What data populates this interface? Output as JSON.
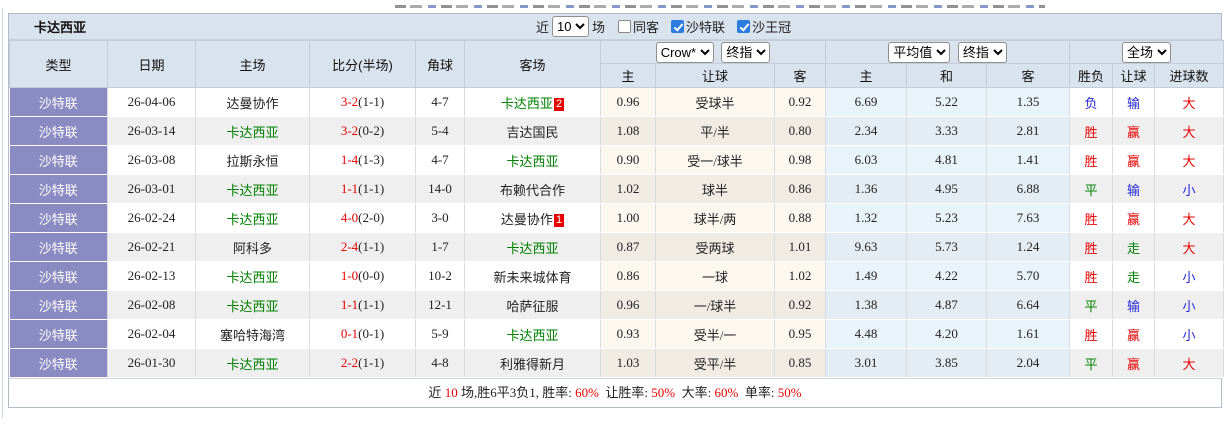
{
  "title_bar": {
    "team": "卡达西亚",
    "near_label": "近",
    "count": "10",
    "matches_label": "场",
    "checkboxes": [
      {
        "label": "同客",
        "checked": false
      },
      {
        "label": "沙特联",
        "checked": true
      },
      {
        "label": "沙王冠",
        "checked": true
      }
    ]
  },
  "header": {
    "static_columns": [
      "类型",
      "日期",
      "主场",
      "比分(半场)",
      "角球",
      "客场"
    ],
    "selects": {
      "crow": "Crow*",
      "crow_final": "终指",
      "avg": "平均值",
      "avg_final": "终指",
      "scope": "全场"
    },
    "sub_columns": [
      "主",
      "让球",
      "客",
      "主",
      "和",
      "客",
      "胜负",
      "让球",
      "进球数"
    ]
  },
  "rows": [
    {
      "league": "沙特联",
      "date": "26-04-06",
      "home": "达曼协作",
      "home_color": "black",
      "ft": "3-2",
      "ht": "(1-1)",
      "corner": "4-7",
      "away": "卡达西亚",
      "away_color": "green",
      "badge": "2",
      "crow_home": "0.96",
      "handicap": "受球半",
      "crow_away": "0.92",
      "avg_home": "6.69",
      "avg_draw": "5.22",
      "avg_away": "1.35",
      "wdl": "负",
      "wdl_color": "blue",
      "hres": "输",
      "hres_color": "blue",
      "goals": "大",
      "goals_color": "red"
    },
    {
      "league": "沙特联",
      "date": "26-03-14",
      "home": "卡达西亚",
      "home_color": "green",
      "ft": "3-2",
      "ht": "(0-2)",
      "corner": "5-4",
      "away": "吉达国民",
      "away_color": "black",
      "badge": "",
      "crow_home": "1.08",
      "handicap": "平/半",
      "crow_away": "0.80",
      "avg_home": "2.34",
      "avg_draw": "3.33",
      "avg_away": "2.81",
      "wdl": "胜",
      "wdl_color": "red",
      "hres": "赢",
      "hres_color": "red",
      "goals": "大",
      "goals_color": "red"
    },
    {
      "league": "沙特联",
      "date": "26-03-08",
      "home": "拉斯永恒",
      "home_color": "black",
      "ft": "1-4",
      "ht": "(1-3)",
      "corner": "4-7",
      "away": "卡达西亚",
      "away_color": "green",
      "badge": "",
      "crow_home": "0.90",
      "handicap": "受一/球半",
      "crow_away": "0.98",
      "avg_home": "6.03",
      "avg_draw": "4.81",
      "avg_away": "1.41",
      "wdl": "胜",
      "wdl_color": "red",
      "hres": "赢",
      "hres_color": "red",
      "goals": "大",
      "goals_color": "red"
    },
    {
      "league": "沙特联",
      "date": "26-03-01",
      "home": "卡达西亚",
      "home_color": "green",
      "ft": "1-1",
      "ht": "(1-1)",
      "corner": "14-0",
      "away": "布赖代合作",
      "away_color": "black",
      "badge": "",
      "crow_home": "1.02",
      "handicap": "球半",
      "crow_away": "0.86",
      "avg_home": "1.36",
      "avg_draw": "4.95",
      "avg_away": "6.88",
      "wdl": "平",
      "wdl_color": "green",
      "hres": "输",
      "hres_color": "blue",
      "goals": "小",
      "goals_color": "blue"
    },
    {
      "league": "沙特联",
      "date": "26-02-24",
      "home": "卡达西亚",
      "home_color": "green",
      "ft": "4-0",
      "ht": "(2-0)",
      "corner": "3-0",
      "away": "达曼协作",
      "away_color": "black",
      "badge": "1",
      "crow_home": "1.00",
      "handicap": "球半/两",
      "crow_away": "0.88",
      "avg_home": "1.32",
      "avg_draw": "5.23",
      "avg_away": "7.63",
      "wdl": "胜",
      "wdl_color": "red",
      "hres": "赢",
      "hres_color": "red",
      "goals": "大",
      "goals_color": "red"
    },
    {
      "league": "沙特联",
      "date": "26-02-21",
      "home": "阿科多",
      "home_color": "black",
      "ft": "2-4",
      "ht": "(1-1)",
      "corner": "1-7",
      "away": "卡达西亚",
      "away_color": "green",
      "badge": "",
      "crow_home": "0.87",
      "handicap": "受两球",
      "crow_away": "1.01",
      "avg_home": "9.63",
      "avg_draw": "5.73",
      "avg_away": "1.24",
      "wdl": "胜",
      "wdl_color": "red",
      "hres": "走",
      "hres_color": "green",
      "goals": "大",
      "goals_color": "red"
    },
    {
      "league": "沙特联",
      "date": "26-02-13",
      "home": "卡达西亚",
      "home_color": "green",
      "ft": "1-0",
      "ht": "(0-0)",
      "corner": "10-2",
      "away": "新未来城体育",
      "away_color": "black",
      "badge": "",
      "crow_home": "0.86",
      "handicap": "一球",
      "crow_away": "1.02",
      "avg_home": "1.49",
      "avg_draw": "4.22",
      "avg_away": "5.70",
      "wdl": "胜",
      "wdl_color": "red",
      "hres": "走",
      "hres_color": "green",
      "goals": "小",
      "goals_color": "blue"
    },
    {
      "league": "沙特联",
      "date": "26-02-08",
      "home": "卡达西亚",
      "home_color": "green",
      "ft": "1-1",
      "ht": "(1-1)",
      "corner": "12-1",
      "away": "哈萨征服",
      "away_color": "black",
      "badge": "",
      "crow_home": "0.96",
      "handicap": "一/球半",
      "crow_away": "0.92",
      "avg_home": "1.38",
      "avg_draw": "4.87",
      "avg_away": "6.64",
      "wdl": "平",
      "wdl_color": "green",
      "hres": "输",
      "hres_color": "blue",
      "goals": "小",
      "goals_color": "blue"
    },
    {
      "league": "沙特联",
      "date": "26-02-04",
      "home": "塞哈特海湾",
      "home_color": "black",
      "ft": "0-1",
      "ht": "(0-1)",
      "corner": "5-9",
      "away": "卡达西亚",
      "away_color": "green",
      "badge": "",
      "crow_home": "0.93",
      "handicap": "受半/一",
      "crow_away": "0.95",
      "avg_home": "4.48",
      "avg_draw": "4.20",
      "avg_away": "1.61",
      "wdl": "胜",
      "wdl_color": "red",
      "hres": "赢",
      "hres_color": "red",
      "goals": "小",
      "goals_color": "blue"
    },
    {
      "league": "沙特联",
      "date": "26-01-30",
      "home": "卡达西亚",
      "home_color": "green",
      "ft": "2-2",
      "ht": "(1-1)",
      "corner": "4-8",
      "away": "利雅得新月",
      "away_color": "black",
      "badge": "",
      "crow_home": "1.03",
      "handicap": "受平/半",
      "crow_away": "0.85",
      "avg_home": "3.01",
      "avg_draw": "3.85",
      "avg_away": "2.04",
      "wdl": "平",
      "wdl_color": "green",
      "hres": "赢",
      "hres_color": "red",
      "goals": "大",
      "goals_color": "red"
    }
  ],
  "footer": {
    "segments": [
      {
        "text": "近",
        "color": "black"
      },
      {
        "text": "10",
        "color": "red"
      },
      {
        "text": "场,胜6平3负1, 胜率:",
        "color": "black"
      },
      {
        "text": "60%",
        "color": "red"
      },
      {
        "text": " 让胜率:",
        "color": "black"
      },
      {
        "text": "50%",
        "color": "red"
      },
      {
        "text": " 大率:",
        "color": "black"
      },
      {
        "text": "60%",
        "color": "red"
      },
      {
        "text": " 单率:",
        "color": "black"
      },
      {
        "text": "50%",
        "color": "red"
      }
    ]
  },
  "colors": {
    "accent_red": "#e60000",
    "accent_blue": "#2626d9",
    "accent_green": "#008000",
    "type_column_purple": "#8b8bc3",
    "header_bg": "#d9e3ee",
    "crow_columns_bg": "#fcf7ef",
    "avg_columns_bg": "#e9f3fa",
    "checkbox_checked_blue": "#2d7de1"
  }
}
